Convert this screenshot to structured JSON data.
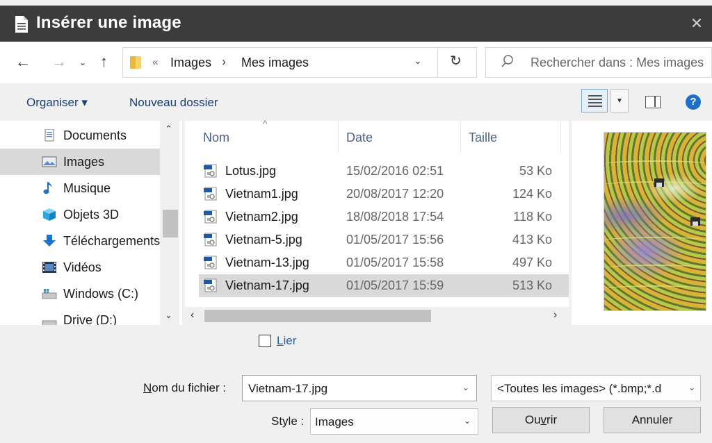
{
  "window": {
    "title": "Insérer une image",
    "close_glyph": "✕"
  },
  "nav": {
    "back_glyph": "←",
    "forward_glyph": "→",
    "recent_glyph": "⌄",
    "up_glyph": "↑",
    "crumb_prefix": "«",
    "breadcrumb": [
      "Images",
      "Mes images"
    ],
    "crumb_separator": "›",
    "dropdown_glyph": "⌄",
    "refresh_glyph": "↻",
    "search_placeholder": "Rechercher dans : Mes images"
  },
  "toolbar": {
    "organise": "Organiser ▾",
    "new_folder": "Nouveau dossier",
    "view_dropdown": "▼",
    "help": "?"
  },
  "sidebar": {
    "items": [
      {
        "label": "Documents",
        "icon": "document-icon",
        "selected": false
      },
      {
        "label": "Images",
        "icon": "pictures-icon",
        "selected": true
      },
      {
        "label": "Musique",
        "icon": "music-icon",
        "selected": false
      },
      {
        "label": "Objets 3D",
        "icon": "cube-3d-icon",
        "selected": false
      },
      {
        "label": "Téléchargements",
        "icon": "download-icon",
        "selected": false
      },
      {
        "label": "Vidéos",
        "icon": "video-icon",
        "selected": false
      },
      {
        "label": "Windows (C:)",
        "icon": "drive-c-icon",
        "selected": false
      },
      {
        "label": "Drive (D:)",
        "icon": "drive-icon",
        "selected": false
      }
    ],
    "scroll_up": "⌃",
    "scroll_down": "⌄"
  },
  "filelist": {
    "sort_glyph": "^",
    "columns": {
      "name": "Nom",
      "date": "Date",
      "size": "Taille"
    },
    "rows": [
      {
        "name": "Lotus.jpg",
        "date": "15/02/2016 02:51",
        "size": "53 Ko",
        "selected": false
      },
      {
        "name": "Vietnam1.jpg",
        "date": "20/08/2017 12:20",
        "size": "124 Ko",
        "selected": false
      },
      {
        "name": "Vietnam2.jpg",
        "date": "18/08/2018 17:54",
        "size": "118 Ko",
        "selected": false
      },
      {
        "name": "Vietnam-5.jpg",
        "date": "01/05/2017 15:56",
        "size": "413 Ko",
        "selected": false
      },
      {
        "name": "Vietnam-13.jpg",
        "date": "01/05/2017 15:58",
        "size": "497 Ko",
        "selected": false
      },
      {
        "name": "Vietnam-17.jpg",
        "date": "01/05/2017 15:59",
        "size": "513 Ko",
        "selected": true
      }
    ],
    "scroll_left": "‹",
    "scroll_right": "›"
  },
  "options": {
    "link_label_first": "L",
    "link_label_rest": "ier",
    "link_checked": false
  },
  "filename": {
    "label_first": "N",
    "label_rest": "om du fichier :",
    "value": "Vietnam-17.jpg",
    "filter_value": "<Toutes les images> (*.bmp;*.d",
    "dropdown_glyph": "⌄"
  },
  "style": {
    "label": "Style :",
    "value": "Images"
  },
  "buttons": {
    "open_pre": "Ou",
    "open_u": "v",
    "open_post": "rir",
    "cancel": "Annuler"
  },
  "colors": {
    "titlebar": "#3c3c3c",
    "selection": "#d9d9d9",
    "accent": "#1f6fc8",
    "folder": "#e9b93a"
  }
}
